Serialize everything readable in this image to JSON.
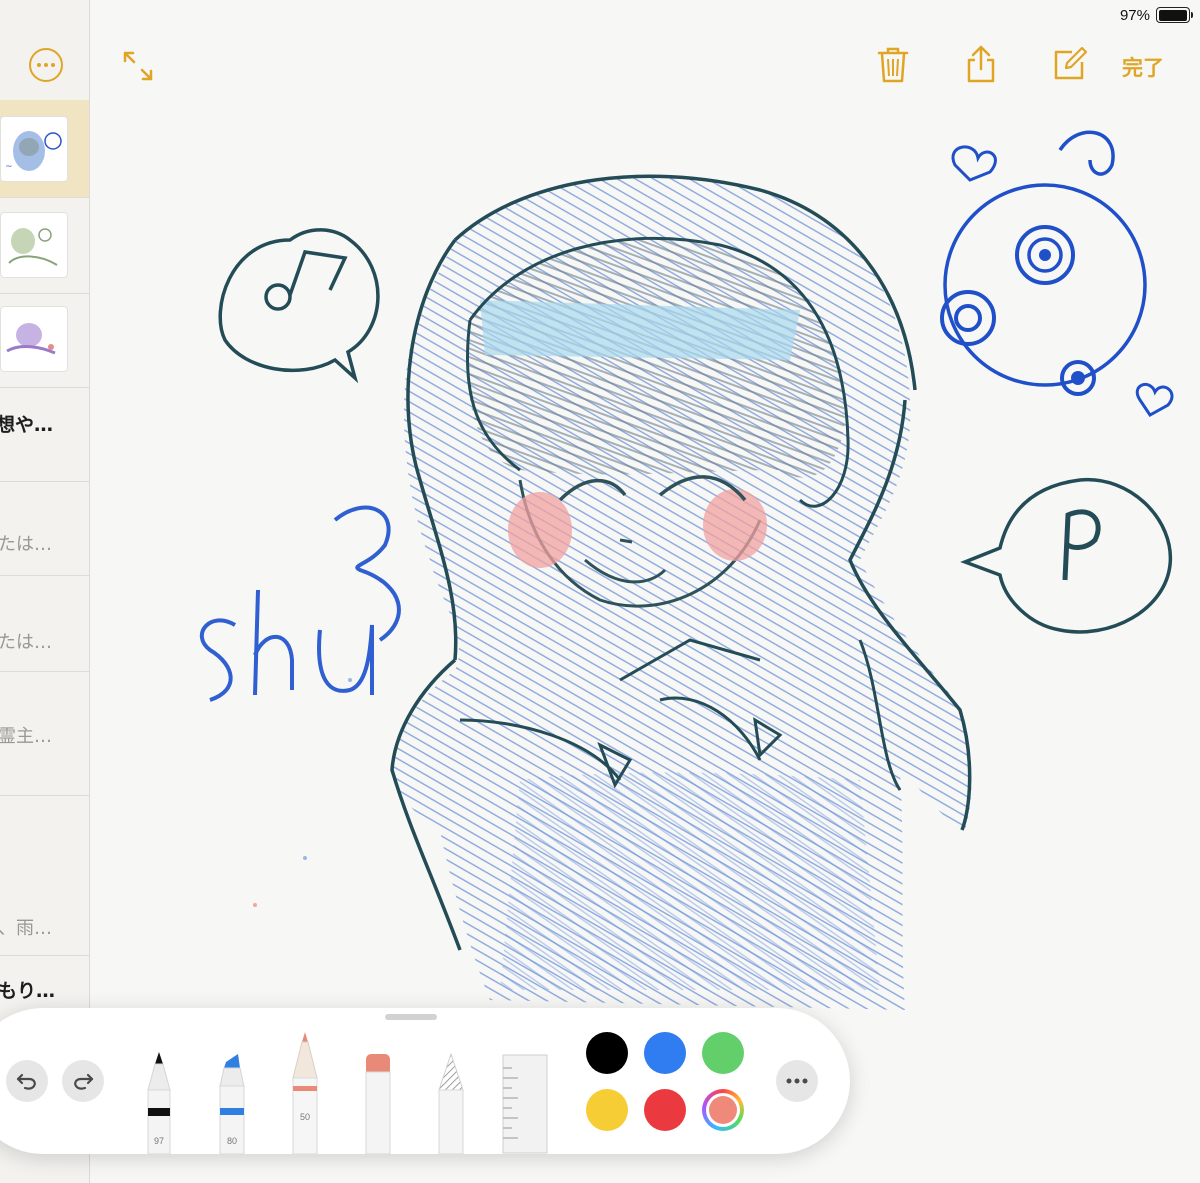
{
  "status": {
    "battery": "97%",
    "battery_level": 0.97
  },
  "sidebar": {
    "rows": [
      {
        "kind": "thumb",
        "selected": true
      },
      {
        "kind": "thumb",
        "selected": false
      },
      {
        "kind": "thumb",
        "selected": false
      },
      {
        "kind": "text",
        "text": "想や…",
        "style": "title"
      },
      {
        "kind": "text",
        "text": "たは…",
        "style": "sub"
      },
      {
        "kind": "text",
        "text": "たは…",
        "style": "sub"
      },
      {
        "kind": "text",
        "text": "霊主…",
        "style": "sub"
      },
      {
        "kind": "text",
        "text": "、雨…",
        "style": "sub"
      },
      {
        "kind": "text",
        "text": "もり…",
        "style": "title"
      }
    ]
  },
  "toolbar": {
    "done_label": "完了"
  },
  "drawing": {
    "signature": "Shu"
  },
  "palette": {
    "tools": [
      {
        "name": "pen",
        "width_value": "97",
        "color": "#111111"
      },
      {
        "name": "marker",
        "width_value": "80",
        "color": "#2f7fe0"
      },
      {
        "name": "pencil",
        "width_value": "50",
        "color": "#e98a78"
      },
      {
        "name": "eraser",
        "width_value": "",
        "color": "#e98a78"
      },
      {
        "name": "lasso",
        "width_value": "",
        "color": "#bbbbbb"
      },
      {
        "name": "ruler",
        "width_value": "",
        "color": "#cccccc"
      }
    ],
    "colors": [
      "#000000",
      "#2f7df0",
      "#63cf6a",
      "#f7cd35",
      "#ea3a3f",
      "#ef8a7b"
    ],
    "selected_color": "#ef8a7b"
  }
}
